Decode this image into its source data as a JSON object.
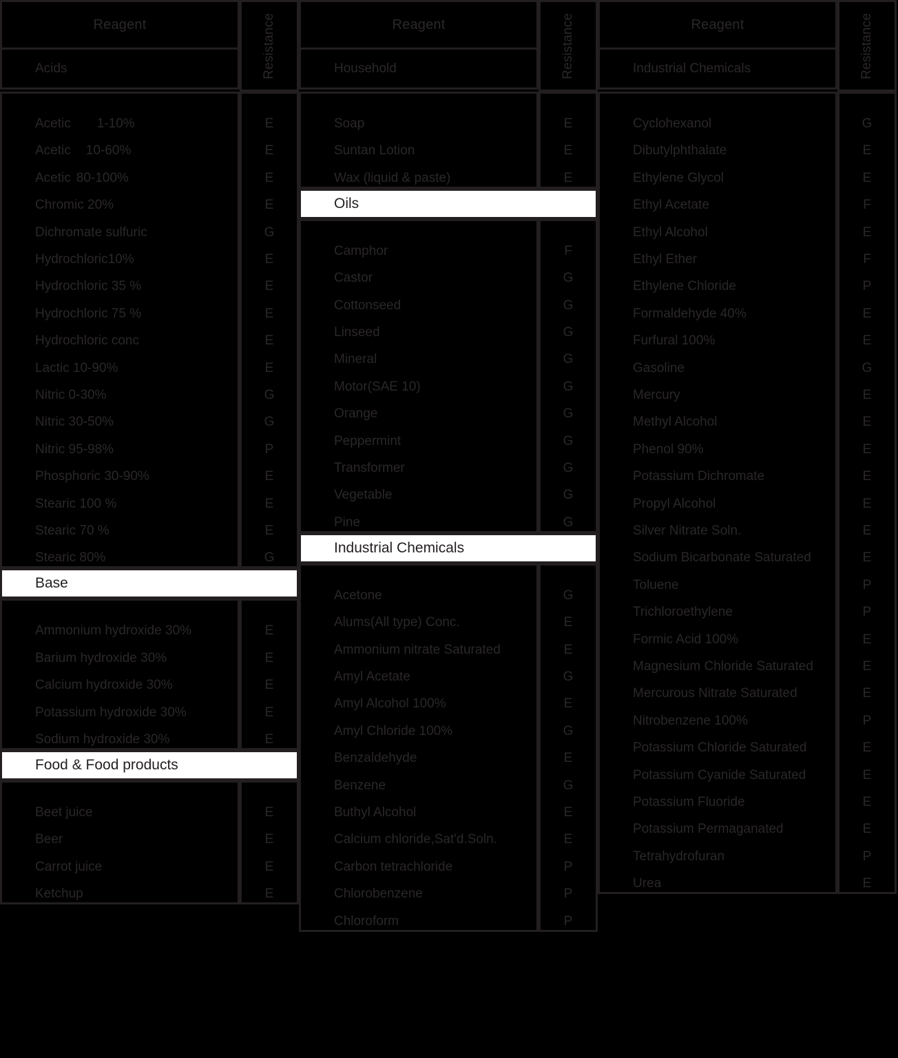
{
  "table": {
    "column_headers": {
      "reagent": "Reagent",
      "resistance": "Resistance"
    },
    "grade_legend": [
      "E",
      "G",
      "F",
      "P"
    ],
    "colors": {
      "background": "#000000",
      "border": "#231f20",
      "text": "#2b2728",
      "header_bar_background": "#ffffff",
      "header_bar_text": "#231f20"
    }
  },
  "columns": [
    {
      "id": "column-1",
      "header": "Reagent",
      "resistance_header": "Resistance",
      "subhead": "Acids",
      "sections": [
        {
          "id": "acids",
          "title": "Acids",
          "title_style": "dark-subhead",
          "rows": [
            {
              "name": "Acetic",
              "conc": "1-10%",
              "grade": "E"
            },
            {
              "name": "Acetic",
              "conc": "10-60%",
              "grade": "E"
            },
            {
              "name": "Acetic",
              "conc": "80-100%",
              "grade": "E"
            },
            {
              "name": "Chromic 20%",
              "conc": "",
              "grade": "E"
            },
            {
              "name": "Dichromate sulfuric",
              "conc": "",
              "grade": "G"
            },
            {
              "name": "Hydrochloric10%",
              "conc": "",
              "grade": "E"
            },
            {
              "name": "Hydrochloric 35 %",
              "conc": "",
              "grade": "E"
            },
            {
              "name": "Hydrochloric 75 %",
              "conc": "",
              "grade": "E"
            },
            {
              "name": "Hydrochloric conc",
              "conc": "",
              "grade": "E"
            },
            {
              "name": "Lactic 10-90%",
              "conc": "",
              "grade": "E"
            },
            {
              "name": "Nitric 0-30%",
              "conc": "",
              "grade": "G"
            },
            {
              "name": "Nitric 30-50%",
              "conc": "",
              "grade": "G"
            },
            {
              "name": "Nitric 95-98%",
              "conc": "",
              "grade": "P"
            },
            {
              "name": "Phosphoric 30-90%",
              "conc": "",
              "grade": "E"
            },
            {
              "name": "Stearic 100 %",
              "conc": "",
              "grade": "E"
            },
            {
              "name": "Stearic  70 %",
              "conc": "",
              "grade": "E"
            },
            {
              "name": "Stearic  80%",
              "conc": "",
              "grade": "G"
            }
          ]
        },
        {
          "id": "base",
          "title": "Base",
          "title_style": "white-bar",
          "rows": [
            {
              "name": "Ammonium hydroxide 30%",
              "conc": "",
              "grade": "E"
            },
            {
              "name": "Barium hydroxide 30%",
              "conc": "",
              "grade": "E"
            },
            {
              "name": "Calcium hydroxide 30%",
              "conc": "",
              "grade": "E"
            },
            {
              "name": "Potassium hydroxide 30%",
              "conc": "",
              "grade": "E"
            },
            {
              "name": "Sodium hydroxide 30%",
              "conc": "",
              "grade": "E"
            }
          ]
        },
        {
          "id": "food",
          "title": "Food & Food products",
          "title_style": "white-bar",
          "rows": [
            {
              "name": "Beet juice",
              "conc": "",
              "grade": "E"
            },
            {
              "name": "Beer",
              "conc": "",
              "grade": "E"
            },
            {
              "name": "Carrot juice",
              "conc": "",
              "grade": "E"
            },
            {
              "name": "Ketchup",
              "conc": "",
              "grade": "E"
            }
          ]
        }
      ]
    },
    {
      "id": "column-2",
      "header": "Reagent",
      "resistance_header": "Resistance",
      "subhead": "Household",
      "sections": [
        {
          "id": "household",
          "title": "Household",
          "title_style": "dark-subhead",
          "rows": [
            {
              "name": "Soap",
              "conc": "",
              "grade": "E"
            },
            {
              "name": "Suntan Lotion",
              "conc": "",
              "grade": "E"
            },
            {
              "name": "Wax (liquid  & paste)",
              "conc": "",
              "grade": "E"
            }
          ]
        },
        {
          "id": "oils",
          "title": "Oils",
          "title_style": "white-bar",
          "rows": [
            {
              "name": "Camphor",
              "conc": "",
              "grade": "F"
            },
            {
              "name": "Castor",
              "conc": "",
              "grade": "G"
            },
            {
              "name": "Cottonseed",
              "conc": "",
              "grade": "G"
            },
            {
              "name": "Linseed",
              "conc": "",
              "grade": "G"
            },
            {
              "name": "Mineral",
              "conc": "",
              "grade": "G"
            },
            {
              "name": "Motor(SAE 10)",
              "conc": "",
              "grade": "G"
            },
            {
              "name": "Orange",
              "conc": "",
              "grade": "G"
            },
            {
              "name": "Peppermint",
              "conc": "",
              "grade": "G"
            },
            {
              "name": "Transformer",
              "conc": "",
              "grade": "G"
            },
            {
              "name": "Vegetable",
              "conc": "",
              "grade": "G"
            },
            {
              "name": "Pine",
              "conc": "",
              "grade": "G"
            }
          ]
        },
        {
          "id": "industrial-chemicals-2",
          "title": "Industrial Chemicals",
          "title_style": "white-bar",
          "rows": [
            {
              "name": "Acetone",
              "conc": "",
              "grade": "G"
            },
            {
              "name": "Alums(All type) Conc.",
              "conc": "",
              "grade": "E"
            },
            {
              "name": "Ammonium nitrate Saturated",
              "conc": "",
              "grade": "E"
            },
            {
              "name": "Amyl Acetate",
              "conc": "",
              "grade": "G"
            },
            {
              "name": "Amyl Alcohol 100%",
              "conc": "",
              "grade": "E"
            },
            {
              "name": "Amyl Chloride 100%",
              "conc": "",
              "grade": "G"
            },
            {
              "name": "Benzaldehyde",
              "conc": "",
              "grade": "E"
            },
            {
              "name": "Benzene",
              "conc": "",
              "grade": "G"
            },
            {
              "name": "Buthyl Alcohol",
              "conc": "",
              "grade": "E"
            },
            {
              "name": "Calcium chloride,Sat'd.Soln.",
              "conc": "",
              "grade": "E"
            },
            {
              "name": "Carbon tetrachloride",
              "conc": "",
              "grade": "P"
            },
            {
              "name": "Chlorobenzene",
              "conc": "",
              "grade": "P"
            },
            {
              "name": "Chloroform",
              "conc": "",
              "grade": "P"
            }
          ]
        }
      ]
    },
    {
      "id": "column-3",
      "header": "Reagent",
      "resistance_header": "Resistance",
      "subhead": "Industrial Chemicals",
      "sections": [
        {
          "id": "industrial-chemicals-3",
          "title": "Industrial Chemicals",
          "title_style": "dark-subhead",
          "rows": [
            {
              "name": "Cyclohexanol",
              "conc": "",
              "grade": "G"
            },
            {
              "name": "Dibutylphthalate",
              "conc": "",
              "grade": "E"
            },
            {
              "name": "Ethylene Glycol",
              "conc": "",
              "grade": "E"
            },
            {
              "name": "Ethyl Acetate",
              "conc": "",
              "grade": "F"
            },
            {
              "name": "Ethyl Alcohol",
              "conc": "",
              "grade": "E"
            },
            {
              "name": "Ethyl Ether",
              "conc": "",
              "grade": "F"
            },
            {
              "name": "Ethylene Chloride",
              "conc": "",
              "grade": "P"
            },
            {
              "name": "Formaldehyde 40%",
              "conc": "",
              "grade": "E"
            },
            {
              "name": "Furfural 100%",
              "conc": "",
              "grade": "E"
            },
            {
              "name": "Gasoline",
              "conc": "",
              "grade": "G"
            },
            {
              "name": "Mercury",
              "conc": "",
              "grade": "E"
            },
            {
              "name": "Methyl Alcohol",
              "conc": "",
              "grade": "E"
            },
            {
              "name": "Phenol 90%",
              "conc": "",
              "grade": "E"
            },
            {
              "name": "Potassium Dichromate",
              "conc": "",
              "grade": "E"
            },
            {
              "name": "Propyl Alcohol",
              "conc": "",
              "grade": "E"
            },
            {
              "name": "Silver Nitrate Soln.",
              "conc": "",
              "grade": "E"
            },
            {
              "name": "Sodium Bicarbonate Saturated",
              "conc": "",
              "grade": "E"
            },
            {
              "name": "Toluene",
              "conc": "",
              "grade": "P"
            },
            {
              "name": "Trichloroethylene",
              "conc": "",
              "grade": "P"
            },
            {
              "name": "Formic Acid 100%",
              "conc": "",
              "grade": "E"
            },
            {
              "name": "Magnesium Chloride Saturated",
              "conc": "",
              "grade": "E"
            },
            {
              "name": "Mercurous Nitrate Saturated",
              "conc": "",
              "grade": "E"
            },
            {
              "name": "Nitrobenzene 100%",
              "conc": "",
              "grade": "P"
            },
            {
              "name": "Potassium Chloride Saturated",
              "conc": "",
              "grade": "E"
            },
            {
              "name": "Potassium Cyanide Saturated",
              "conc": "",
              "grade": "E"
            },
            {
              "name": "Potassium  Fluoride",
              "conc": "",
              "grade": "E"
            },
            {
              "name": "Potassium Permaganated",
              "conc": "",
              "grade": "E"
            },
            {
              "name": "Tetrahydrofuran",
              "conc": "",
              "grade": "P"
            },
            {
              "name": "Urea",
              "conc": "",
              "grade": "E"
            }
          ]
        }
      ]
    }
  ]
}
